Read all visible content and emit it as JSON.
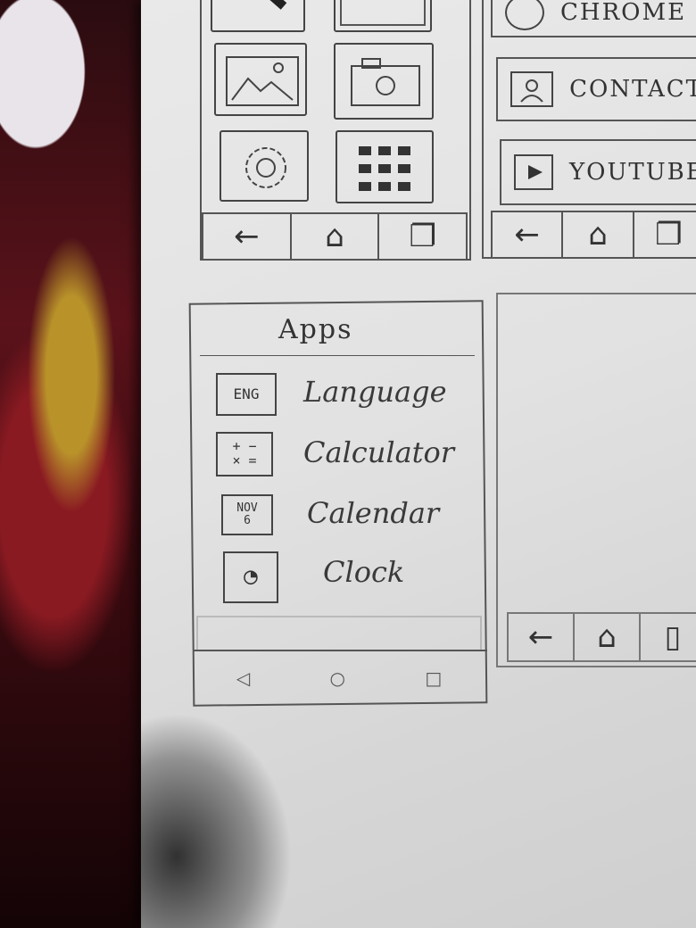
{
  "left_panel_top": {
    "tiles": [
      {
        "icon": "pencil-icon"
      },
      {
        "icon": "window-icon"
      },
      {
        "icon": "gallery-icon"
      },
      {
        "icon": "camera-icon"
      },
      {
        "icon": "settings-gear-icon"
      },
      {
        "icon": "app-grid-icon"
      }
    ],
    "nav": [
      {
        "glyph": "←",
        "icon": "back-arrow-icon"
      },
      {
        "glyph": "⌂",
        "icon": "home-icon"
      },
      {
        "glyph": "❐",
        "icon": "recents-icon"
      }
    ]
  },
  "right_panel_top": {
    "items": [
      {
        "label": "CHROME",
        "icon": "chrome-icon"
      },
      {
        "label": "CONTACT",
        "icon": "contact-icon"
      },
      {
        "label": "YOUTUBE",
        "icon": "youtube-play-icon"
      }
    ],
    "nav": [
      {
        "glyph": "←",
        "icon": "back-arrow-icon"
      },
      {
        "glyph": "⌂",
        "icon": "home-icon"
      },
      {
        "glyph": "❐",
        "icon": "recents-icon"
      }
    ]
  },
  "apps_screen": {
    "title": "Apps",
    "apps": [
      {
        "label": "Language",
        "icon_text": "ENG",
        "icon": "language-icon"
      },
      {
        "label": "Calculator",
        "icon_text": "+ −\n× =",
        "icon": "calculator-icon"
      },
      {
        "label": "Calendar",
        "icon_text": "NOV\n6",
        "icon": "calendar-icon"
      },
      {
        "label": "Clock",
        "icon_text": "◔",
        "icon": "clock-icon"
      }
    ],
    "system_nav": [
      {
        "glyph": "◁",
        "icon": "system-back-icon"
      },
      {
        "glyph": "○",
        "icon": "system-home-icon"
      },
      {
        "glyph": "□",
        "icon": "system-recents-icon"
      }
    ]
  },
  "blank_screen": {
    "nav": [
      {
        "glyph": "←",
        "icon": "back-arrow-icon"
      },
      {
        "glyph": "⌂",
        "icon": "home-icon"
      },
      {
        "glyph": "▯",
        "icon": "recents-icon"
      }
    ]
  }
}
